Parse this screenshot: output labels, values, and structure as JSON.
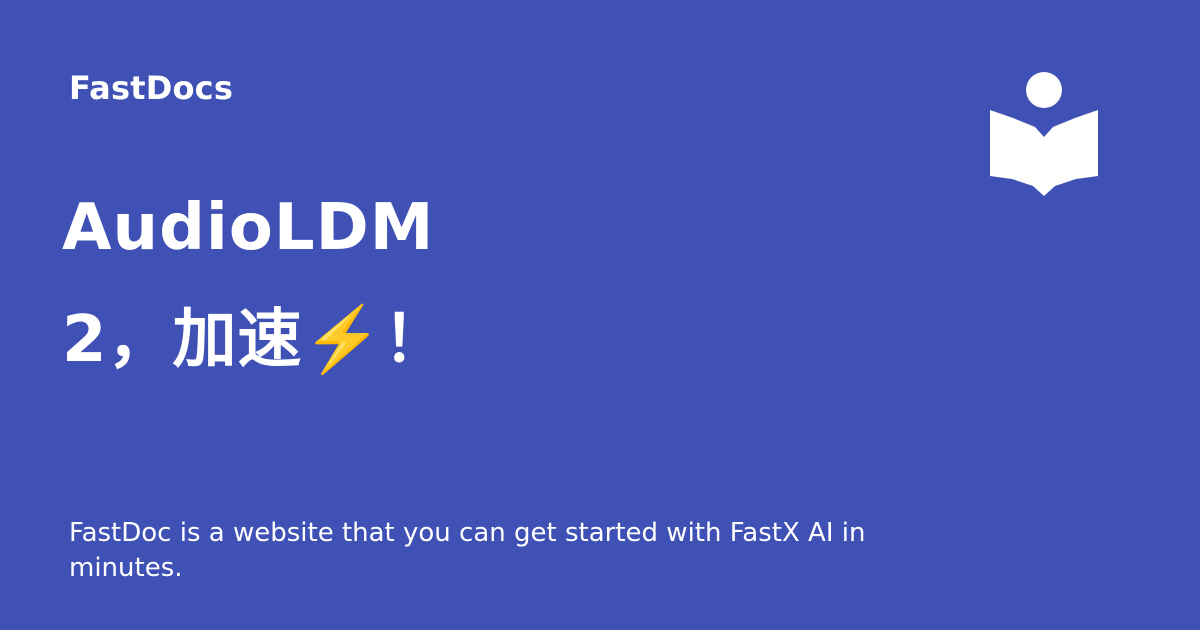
{
  "brand": {
    "name": "FastDocs"
  },
  "title": {
    "line1": "AudioLDM",
    "line2": "2，加速⚡️！"
  },
  "description": "FastDoc is a website that you can get started with FastX AI in minutes.",
  "logo": {
    "icon": "reader-book-icon",
    "color": "#ffffff"
  },
  "colors": {
    "background": "#3f51b5",
    "text": "#ffffff"
  }
}
